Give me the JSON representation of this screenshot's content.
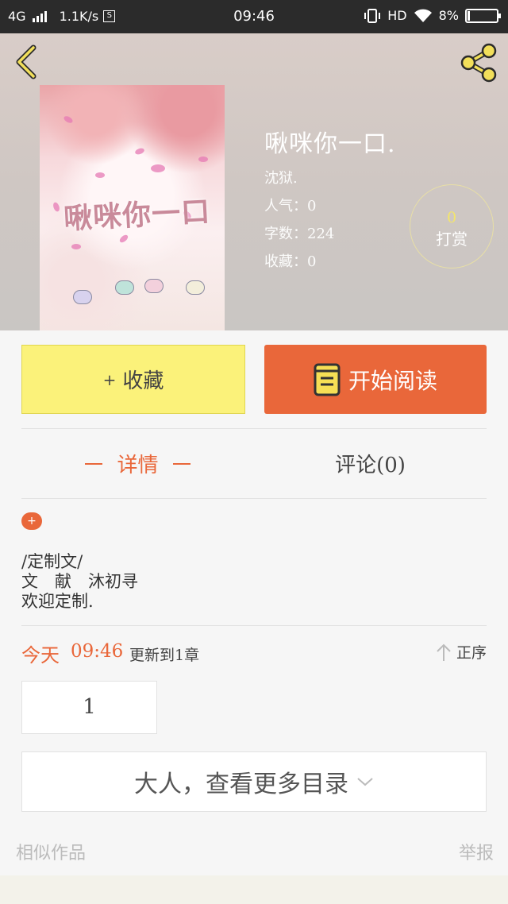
{
  "status_bar": {
    "network": "4G",
    "speed": "1.1K/s",
    "sim_icon_text": "S",
    "time": "09:46",
    "hd": "HD",
    "battery": "8%",
    "battery_level": 0.08
  },
  "header": {
    "back_icon": "chevron-left-icon",
    "share_icon": "share-icon",
    "accent_color": "#f2df5a"
  },
  "book": {
    "cover_text": "啾咪你一口",
    "title": "啾咪你一口.",
    "author": "沈狱.",
    "popularity": "人气：0",
    "word_count": "字数：224",
    "favorites": "收藏：0"
  },
  "tip": {
    "count": "0",
    "label": "打赏"
  },
  "actions": {
    "collect_plus": "+",
    "collect_label": "收藏",
    "read_label": "开始阅读",
    "read_icon": "book-icon",
    "collect_color": "#fbf27a",
    "read_color": "#e9673a"
  },
  "tabs": {
    "detail": "详情",
    "comment": "评论(0)"
  },
  "detail": {
    "expand_label": "+",
    "description": "/定制文/\n文　献　沐初寻\n欢迎定制."
  },
  "updates": {
    "today": "今天",
    "time": "09:46",
    "text": "更新到1章",
    "sort_label": "正序",
    "sort_icon": "arrow-up-icon"
  },
  "chapters": {
    "items": [
      "1"
    ],
    "more_label": "大人，查看更多目录",
    "more_icon": "chevron-down-icon"
  },
  "footer": {
    "similar": "相似作品",
    "report": "举报"
  }
}
